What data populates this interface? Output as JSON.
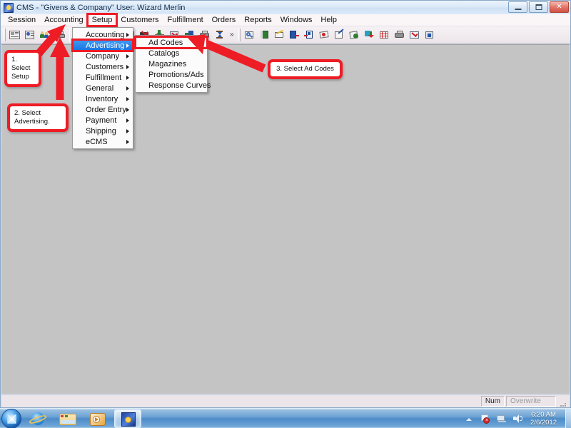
{
  "window": {
    "title": "CMS - \"Givens & Company\"   User: Wizard Merlin",
    "icon": "app-icon",
    "buttons": {
      "minimize": "–",
      "maximize": "□",
      "close": "✕"
    }
  },
  "menubar": {
    "items": [
      {
        "label": "Session",
        "highlighted": false
      },
      {
        "label": "Accounting",
        "highlighted": false
      },
      {
        "label": "Setup",
        "highlighted": true
      },
      {
        "label": "Customers",
        "highlighted": false
      },
      {
        "label": "Fulfillment",
        "highlighted": false
      },
      {
        "label": "Orders",
        "highlighted": false
      },
      {
        "label": "Reports",
        "highlighted": false
      },
      {
        "label": "Windows",
        "highlighted": false
      },
      {
        "label": "Help",
        "highlighted": false
      }
    ]
  },
  "toolbar": {
    "overflow_label": "»",
    "groups": [
      {
        "icons": [
          "newspaper-icon",
          "customer-card-icon",
          "people-icon",
          "printer-icon"
        ]
      },
      {
        "icons": [
          "red-item-icon",
          "green-item-icon",
          "calendar-check-icon"
        ]
      },
      {
        "icons": [
          "chart-icon",
          "check-stamp-icon",
          "inbox-down-icon",
          "shield-check-icon",
          "puzzle-icon",
          "printer-gray-icon",
          "hourglass-icon"
        ]
      },
      {
        "icons": [
          "search-doc-icon",
          "book-icon",
          "pencil-note-icon",
          "door-out-icon",
          "door-in-icon",
          "note-red-icon",
          "note-edit-icon",
          "note-gear-icon",
          "arrow-down-green-icon",
          "grid-icon",
          "printer-small-icon",
          "checkmark-box-icon",
          "lock-add-icon"
        ]
      }
    ]
  },
  "setup_menu": {
    "items": [
      {
        "label": "Accounting",
        "submenu": true,
        "selected": false,
        "boxed": false
      },
      {
        "label": "Advertising",
        "submenu": true,
        "selected": true,
        "boxed": true
      },
      {
        "label": "Company",
        "submenu": true,
        "selected": false,
        "boxed": false
      },
      {
        "label": "Customers",
        "submenu": true,
        "selected": false,
        "boxed": false
      },
      {
        "label": "Fulfillment",
        "submenu": true,
        "selected": false,
        "boxed": false
      },
      {
        "label": "General",
        "submenu": true,
        "selected": false,
        "boxed": false
      },
      {
        "label": "Inventory",
        "submenu": true,
        "selected": false,
        "boxed": false
      },
      {
        "label": "Order Entry",
        "submenu": true,
        "selected": false,
        "boxed": false
      },
      {
        "label": "Payment",
        "submenu": true,
        "selected": false,
        "boxed": false
      },
      {
        "label": "Shipping",
        "submenu": true,
        "selected": false,
        "boxed": false
      },
      {
        "label": "eCMS",
        "submenu": true,
        "selected": false,
        "boxed": false
      }
    ]
  },
  "advertising_submenu": {
    "items": [
      {
        "label": "Ad Codes",
        "boxed": true
      },
      {
        "label": "Catalogs",
        "boxed": false
      },
      {
        "label": "Magazines",
        "boxed": false
      },
      {
        "label": "Promotions/Ads",
        "boxed": false
      },
      {
        "label": "Response Curves",
        "boxed": false
      }
    ]
  },
  "annotations": {
    "accent_color": "#ee1c25",
    "callouts": [
      {
        "id": "callout-1",
        "text": "1. Select Setup"
      },
      {
        "id": "callout-2",
        "text": "2. Select Advertising."
      },
      {
        "id": "callout-3",
        "text": "3. Select Ad Codes"
      }
    ]
  },
  "statusbar": {
    "num_lock": "Num",
    "overwrite": "Overwrite"
  },
  "taskbar": {
    "start": "start-orb",
    "pinned": [
      {
        "name": "internet-explorer-icon"
      },
      {
        "name": "file-explorer-icon"
      },
      {
        "name": "media-player-icon"
      }
    ],
    "active_app": {
      "name": "cms-app-icon"
    },
    "tray": [
      {
        "name": "show-hidden-icons-icon"
      },
      {
        "name": "action-center-flag-icon"
      },
      {
        "name": "network-icon"
      },
      {
        "name": "volume-icon"
      }
    ],
    "clock": {
      "time": "6:20 AM",
      "date": "2/6/2012"
    }
  }
}
